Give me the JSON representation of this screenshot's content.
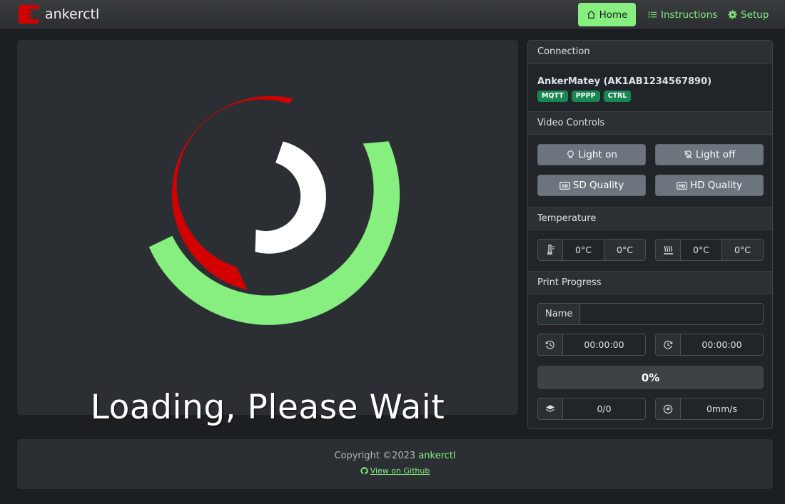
{
  "app": {
    "name": "ankerctl"
  },
  "nav": {
    "home": "Home",
    "instructions": "Instructions",
    "setup": "Setup"
  },
  "loading": {
    "text": "Loading, Please Wait"
  },
  "connection": {
    "header": "Connection",
    "printer": "AnkerMatey (AK1AB1234567890)",
    "badges": [
      "MQTT",
      "PPPP",
      "CTRL"
    ]
  },
  "video_controls": {
    "header": "Video Controls",
    "light_on": "Light on",
    "light_off": "Light off",
    "sd_quality": "SD Quality",
    "hd_quality": "HD Quality"
  },
  "temperature": {
    "header": "Temperature",
    "nozzle": {
      "current": "0°C",
      "target": "0°C"
    },
    "bed": {
      "current": "0°C",
      "target": "0°C"
    }
  },
  "print_progress": {
    "header": "Print Progress",
    "name_label": "Name",
    "name_value": "",
    "elapsed": "00:00:00",
    "remaining": "00:00:00",
    "percent": "0%",
    "percent_value": 0,
    "layers": "0/0",
    "speed": "0mm/s"
  },
  "footer": {
    "copyright_prefix": "Copyright ©2023",
    "copyright_link": "ankerctl",
    "github": "View on Github"
  },
  "colors": {
    "accent": "#86ef7f",
    "spinner_red": "#d40000",
    "spinner_green": "#86ef7f",
    "spinner_white": "#ffffff",
    "badge": "#198754"
  }
}
